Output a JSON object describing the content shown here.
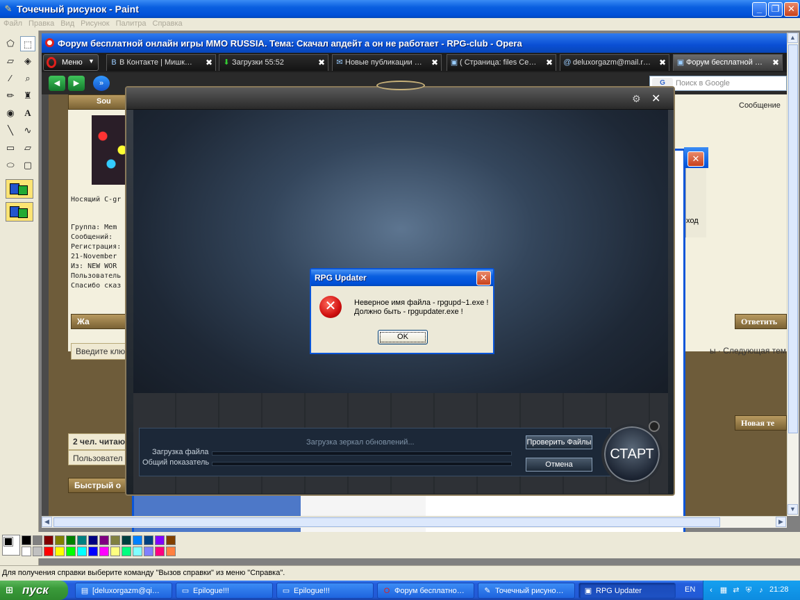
{
  "paint": {
    "title": "Точечный рисунок - Paint",
    "menu": [
      "Файл",
      "Правка",
      "Вид",
      "Рисунок",
      "Палитра",
      "Справка"
    ],
    "status": "Для получения справки выберите команду \"Вызов справки\" из меню \"Справка\".",
    "palette_colors": [
      "#000000",
      "#808080",
      "#800000",
      "#808000",
      "#008000",
      "#008080",
      "#000080",
      "#800080",
      "#808040",
      "#004040",
      "#0080ff",
      "#004080",
      "#8000ff",
      "#804000",
      "#ffffff",
      "#c0c0c0",
      "#ff0000",
      "#ffff00",
      "#00ff00",
      "#00ffff",
      "#0000ff",
      "#ff00ff",
      "#ffff80",
      "#00ff80",
      "#80ffff",
      "#8080ff",
      "#ff0080",
      "#ff8040"
    ]
  },
  "opera": {
    "title": "Форум бесплатной онлайн игры MMO RUSSIA. Тема: Скачал апдейт а он не работает - RPG-club - Opera",
    "menu_label": "Меню",
    "tabs": [
      {
        "label": "В Контакте | Мишк…",
        "icon": "vk-icon"
      },
      {
        "label": "Загрузки 55:52",
        "icon": "download-icon"
      },
      {
        "label": "Новые публикации …",
        "icon": "news-icon"
      },
      {
        "label": "( Страница: files Ce…",
        "icon": "page-icon"
      },
      {
        "label": "deluxorgazm@mail.r…",
        "icon": "mail-icon"
      },
      {
        "label": "Форум бесплатной …",
        "icon": "forum-icon"
      }
    ],
    "search_placeholder": "Поиск в Google",
    "forum": {
      "user_name": "Sou",
      "messages_link": "Сообщение",
      "wearer": "Носящий С-gr",
      "lines": [
        "Группа: Mem",
        "Сообщений:",
        "Регистрация:",
        "21-November",
        "Из: NEW WOR",
        "Пользователь",
        "Спасибо сказ"
      ],
      "reply_btn_left": "Жа",
      "reply_btn_right1": "Ответить",
      "quick_key": "Введите клю",
      "next_theme": "ы · Следующая тем",
      "new_theme": "Новая те",
      "readers": "2 чел. читаю",
      "users": "Пользовател",
      "quick_reply": "Быстрый о"
    }
  },
  "peek": {
    "exit_label": "ход"
  },
  "launcher": {
    "status": "Загрузка зеркал обновлений...",
    "file_label": "Загрузка файла",
    "total_label": "Общий показатель",
    "file_progress": 0,
    "total_progress": 0,
    "check_files": "Проверить Файлы",
    "cancel": "Отмена",
    "start": "СТАРТ"
  },
  "dialog": {
    "title": "RPG Updater",
    "line1": "Неверное имя файла - rpgupd~1.exe !",
    "line2": "Должно быть - rpgupdater.exe !",
    "ok": "OK"
  },
  "taskbar": {
    "start": "пуск",
    "tasks": [
      {
        "label": "[deluxorgazm@qi…",
        "icon": "chat-icon"
      },
      {
        "label": "Epilogue!!!",
        "icon": "folder-icon"
      },
      {
        "label": "Epilogue!!!",
        "icon": "folder-icon"
      },
      {
        "label": "Форум бесплатно…",
        "icon": "opera-icon"
      },
      {
        "label": "Точечный рисуно…",
        "icon": "paint-icon"
      },
      {
        "label": "RPG Updater",
        "icon": "updater-icon",
        "active": true
      }
    ],
    "lang": "EN",
    "clock": "21:28"
  }
}
